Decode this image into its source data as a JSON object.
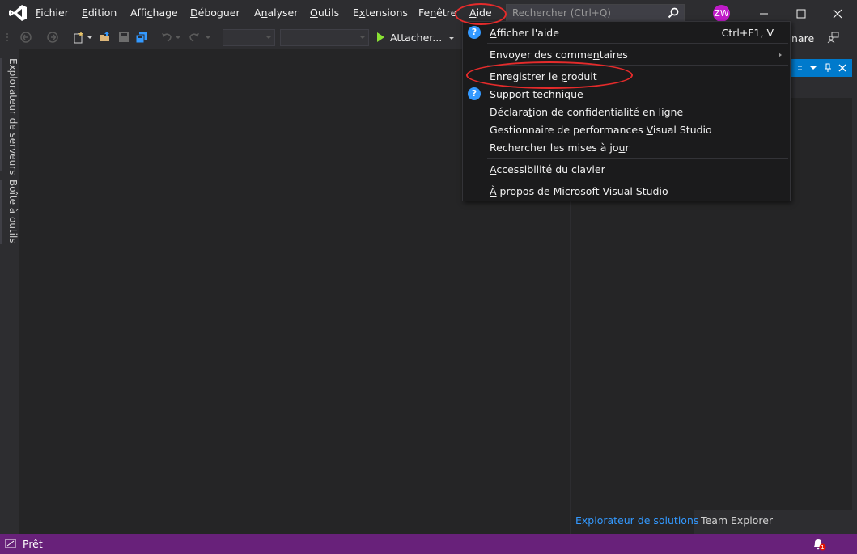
{
  "menu": {
    "items": [
      {
        "label": "Fichier",
        "ul": "F"
      },
      {
        "label": "Edition",
        "ul": "E"
      },
      {
        "label": "Affichage",
        "ul": "c"
      },
      {
        "label": "Déboguer",
        "ul": "D"
      },
      {
        "label": "Analyser",
        "ul": "n"
      },
      {
        "label": "Outils",
        "ul": "O"
      },
      {
        "label": "Extensions",
        "ul": "x"
      },
      {
        "label": "Fenêtre",
        "ul": "n"
      },
      {
        "label": "Aide",
        "ul": "A"
      }
    ]
  },
  "search": {
    "placeholder": "Rechercher (Ctrl+Q)"
  },
  "user": {
    "initials": "ZW"
  },
  "toolbar": {
    "attach_label": "Attacher...",
    "share_label": "nare"
  },
  "left_tabs": [
    "Explorateur de serveurs",
    "Boîte à outils"
  ],
  "help_menu": {
    "items": [
      {
        "label": "Afficher l'aide",
        "shortcut": "Ctrl+F1, V",
        "icon": "help-icon"
      },
      {
        "label": "Envoyer des commentaires",
        "submenu": true
      },
      {
        "label": "Enregistrer le produit"
      },
      {
        "label": "Support technique",
        "icon": "help-icon"
      },
      {
        "label": "Déclaration de confidentialité en ligne"
      },
      {
        "label": "Gestionnaire de performances Visual Studio"
      },
      {
        "label": "Rechercher les mises à jour"
      },
      {
        "label": "Accessibilité du clavier"
      },
      {
        "label": "À propos de Microsoft Visual Studio"
      }
    ]
  },
  "panel": {
    "tabs": [
      "Explorateur de solutions",
      "Team Explorer"
    ]
  },
  "status": {
    "text": "Prêt",
    "notification_count": "1"
  },
  "colors": {
    "accent": "#007acc",
    "status_bar": "#68217a",
    "annotation": "#e52b2b"
  }
}
